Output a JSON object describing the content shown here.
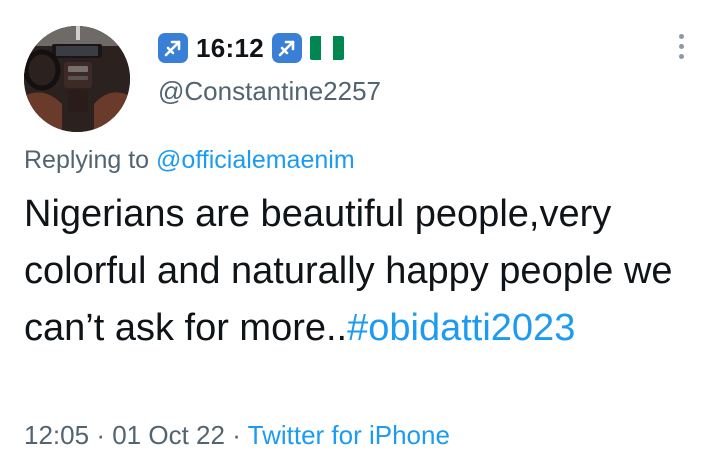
{
  "author": {
    "display_name": "16:12",
    "handle": "@Constantine2257",
    "badge_icon": "sagittarius-icon",
    "flag_icon": "nigeria-flag-icon",
    "flag_colors": [
      "#008751",
      "#ffffff",
      "#008751"
    ]
  },
  "reply": {
    "prefix": "Replying to",
    "target": "@officialemaenim"
  },
  "tweet": {
    "text": "Nigerians are beautiful people,very colorful and naturally happy people we can’t ask for more..",
    "hashtag": "#obidatti2023"
  },
  "meta": {
    "time": "12:05",
    "separator": "·",
    "date": "01 Oct 22",
    "source": "Twitter for iPhone"
  },
  "colors": {
    "link": "#1d9bf0",
    "secondary_text": "#536471",
    "badge": "#3a7fd6"
  }
}
